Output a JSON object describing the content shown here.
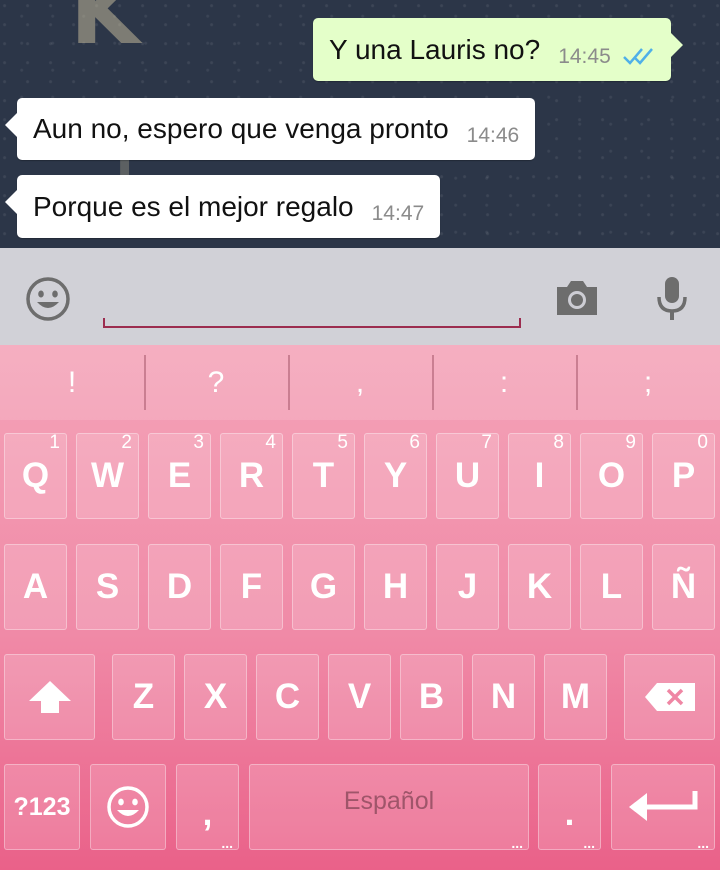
{
  "chat": {
    "messages": [
      {
        "text": "Y una Lauris no?",
        "time": "14:45",
        "direction": "outgoing",
        "status": "read"
      },
      {
        "text": "Aun no, espero que venga pronto",
        "time": "14:46",
        "direction": "incoming"
      },
      {
        "text": "Porque es el mejor regalo",
        "time": "14:47",
        "direction": "incoming"
      }
    ],
    "colors": {
      "outgoing_bubble": "#e4ffc9",
      "incoming_bubble": "#ffffff",
      "read_ticks": "#4fb0e8"
    }
  },
  "input_bar": {
    "icons": {
      "emoji": "emoji-icon",
      "camera": "camera-icon",
      "mic": "microphone-icon"
    },
    "accent": "#9c2d4f"
  },
  "keyboard": {
    "suggestions": [
      "!",
      "?",
      ",",
      ":",
      ";"
    ],
    "row1": [
      {
        "label": "Q",
        "hint": "1"
      },
      {
        "label": "W",
        "hint": "2"
      },
      {
        "label": "E",
        "hint": "3"
      },
      {
        "label": "R",
        "hint": "4"
      },
      {
        "label": "T",
        "hint": "5"
      },
      {
        "label": "Y",
        "hint": "6"
      },
      {
        "label": "U",
        "hint": "7"
      },
      {
        "label": "I",
        "hint": "8"
      },
      {
        "label": "O",
        "hint": "9"
      },
      {
        "label": "P",
        "hint": "0"
      }
    ],
    "row2": [
      "A",
      "S",
      "D",
      "F",
      "G",
      "H",
      "J",
      "K",
      "L",
      "Ñ"
    ],
    "row3": [
      "Z",
      "X",
      "C",
      "V",
      "B",
      "N",
      "M"
    ],
    "bottom": {
      "symbols": "?123",
      "comma": ",",
      "space": "Español",
      "period": "."
    },
    "icons": {
      "shift": "shift-icon",
      "backspace": "backspace-icon",
      "emoji": "emoji-icon",
      "enter": "enter-icon"
    },
    "colors": {
      "top": "#f4a3b8",
      "bottom": "#ea6189"
    }
  }
}
